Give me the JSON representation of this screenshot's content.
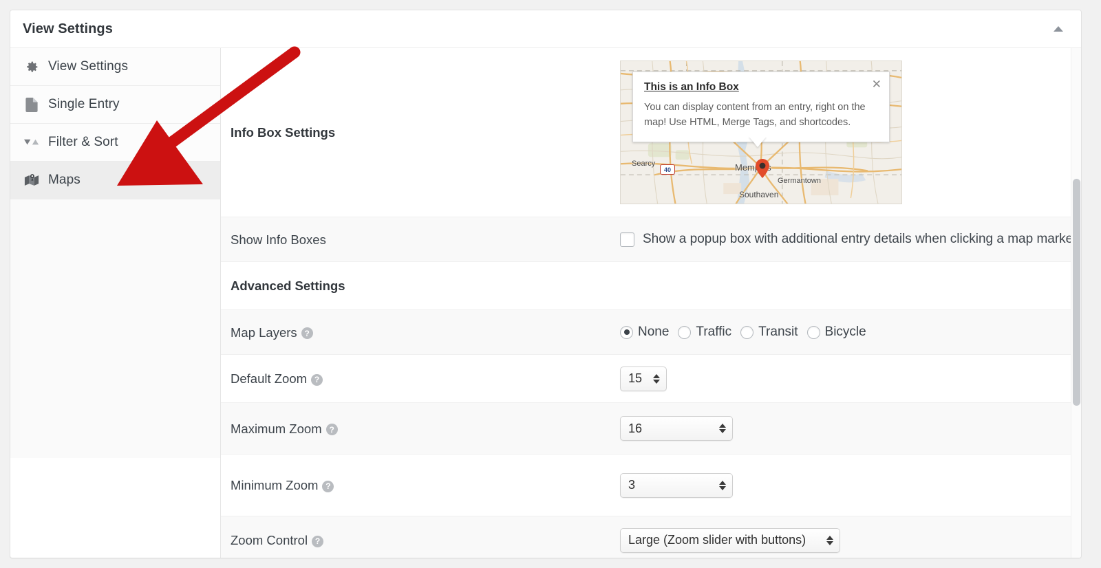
{
  "header": {
    "title": "View Settings",
    "collapse_icon": "caret-up-icon"
  },
  "sidebar": {
    "items": [
      {
        "label": "View Settings",
        "icon": "gear-icon",
        "active": false
      },
      {
        "label": "Single Entry",
        "icon": "page-icon",
        "active": false
      },
      {
        "label": "Filter & Sort",
        "icon": "sort-icon",
        "active": false
      },
      {
        "label": "Maps",
        "icon": "map-icon",
        "active": true
      }
    ]
  },
  "settings": {
    "info_box_settings": {
      "label": "Info Box Settings",
      "preview": {
        "info_box": {
          "title": "This is an Info Box",
          "body": "You can display content from an entry, right on the map! Use HTML, Merge Tags, and shortcodes.",
          "close_icon": "close-icon"
        },
        "map_labels": [
          "Searcy",
          "Memphis",
          "Germantown",
          "Southaven"
        ],
        "highway_shields": [
          "40",
          "40"
        ],
        "marker_icon": "map-pin-icon"
      }
    },
    "show_info_boxes": {
      "label": "Show Info Boxes",
      "checkbox_label": "Show a popup box with additional entry details when clicking a map marker",
      "checked": false
    },
    "advanced_settings": {
      "label": "Advanced Settings"
    },
    "map_layers": {
      "label": "Map Layers",
      "help_icon": "help-icon",
      "options": [
        "None",
        "Traffic",
        "Transit",
        "Bicycle"
      ],
      "selected": "None"
    },
    "default_zoom": {
      "label": "Default Zoom",
      "help_icon": "help-icon",
      "value": "15"
    },
    "maximum_zoom": {
      "label": "Maximum Zoom",
      "help_icon": "help-icon",
      "value": "16"
    },
    "minimum_zoom": {
      "label": "Minimum Zoom",
      "help_icon": "help-icon",
      "value": "3"
    },
    "zoom_control": {
      "label": "Zoom Control",
      "help_icon": "help-icon",
      "value": "Large (Zoom slider with buttons)"
    }
  },
  "annotation": {
    "arrow_color": "#cc1111",
    "points_to": "sidebar-item-maps"
  },
  "colors": {
    "accent_red": "#cc1111",
    "panel_bg": "#ffffff",
    "row_alt_bg": "#f9f9f9",
    "active_nav_bg": "#ededed",
    "text": "#3c434a"
  }
}
